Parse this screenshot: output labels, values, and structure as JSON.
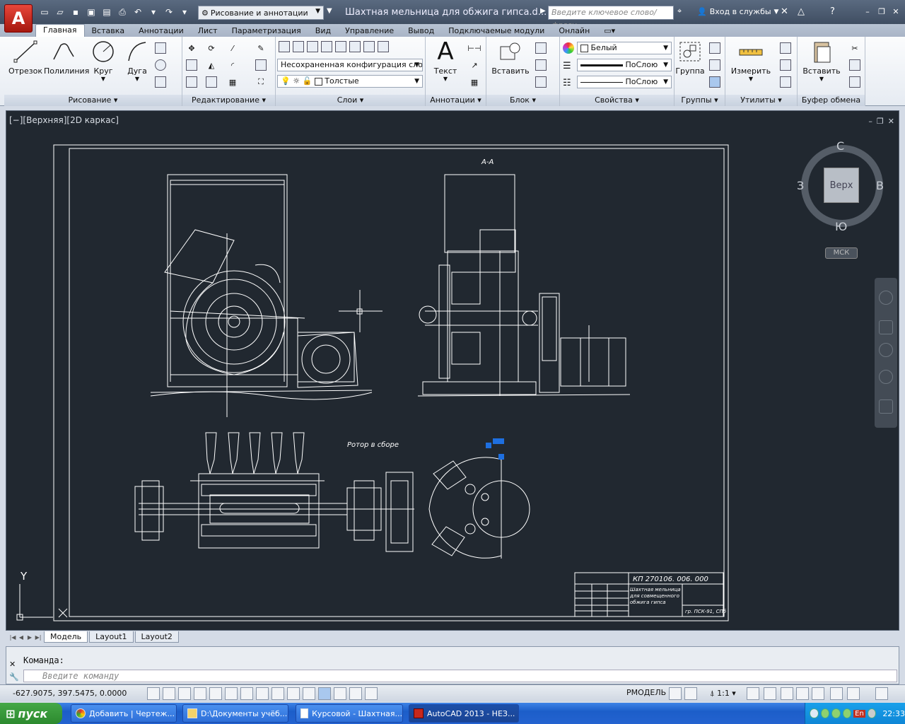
{
  "app": {
    "logo": "A",
    "title": "Шахтная мельница для обжига гипса.d...",
    "workspace": "Рисование и аннотации",
    "search_placeholder": "Введите ключевое слово/фразу",
    "login": "Вход в службы"
  },
  "ribbon": {
    "tabs": [
      "Главная",
      "Вставка",
      "Аннотации",
      "Лист",
      "Параметризация",
      "Вид",
      "Управление",
      "Вывод",
      "Подключаемые модули",
      "Онлайн"
    ],
    "active_tab": 0,
    "panels": {
      "draw": {
        "title": "Рисование",
        "buttons": [
          "Отрезок",
          "Полилиния",
          "Круг",
          "Дуга"
        ]
      },
      "modify": {
        "title": "Редактирование"
      },
      "layers": {
        "title": "Слои",
        "layer_state": "Несохраненная конфигурация слоев",
        "current_layer": "Толстые"
      },
      "annotation": {
        "title": "Аннотации",
        "text_button": "Текст"
      },
      "block": {
        "title": "Блок",
        "insert_button": "Вставить"
      },
      "properties": {
        "title": "Свойства",
        "color": "Белый",
        "linetype": "ПоСлою",
        "lineweight": "ПоСлою"
      },
      "groups": {
        "title": "Группы",
        "group_button": "Группа"
      },
      "utilities": {
        "title": "Утилиты",
        "measure_button": "Измерить"
      },
      "clipboard": {
        "title": "Буфер обмена",
        "paste_button": "Вставить"
      }
    }
  },
  "viewport": {
    "label": "[−][Верхняя][2D каркас]",
    "viewcube": {
      "top": "Верх",
      "north": "С",
      "south": "Ю",
      "west": "З",
      "east": "В"
    },
    "ucs_button": "МСК",
    "axis_y": "Y",
    "drawing_texts": {
      "section": "А-А",
      "rotor_title": "Ротор в сборе",
      "doc_code": "КП 270106. 006. 000",
      "doc_name_1": "Шахтная мельница",
      "doc_name_2": "для совмещенного",
      "doc_name_3": "обжига гипса",
      "group": "гр. ПСК-91, СПб"
    }
  },
  "layout_tabs": [
    "Модель",
    "Layout1",
    "Layout2"
  ],
  "active_layout": 0,
  "command": {
    "history": "Команда:",
    "placeholder": "Введите команду"
  },
  "status": {
    "coords": "-627.9075, 397.5475, 0.0000",
    "space": "РМОДЕЛЬ",
    "scale": "1:1"
  },
  "taskbar": {
    "start": "пуск",
    "tasks": [
      "Добавить | Чертеж...",
      "D:\\Документы учёб...",
      "Курсовой - Шахтная...",
      "AutoCAD 2013 - НЕЗ..."
    ],
    "active_task": 3,
    "lang": "En",
    "clock": "22:33"
  },
  "colors": {
    "canvas": "#212830",
    "line": "#ffffff",
    "selection": "#1e6fe0",
    "accent": "#c8281c"
  }
}
